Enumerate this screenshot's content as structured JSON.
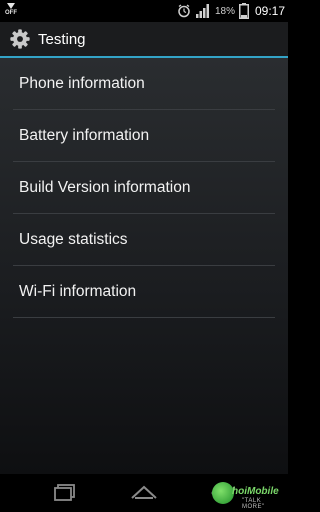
{
  "status_bar": {
    "off_label": "OFF",
    "battery_percent": "18%",
    "time": "09:17",
    "icons": [
      "download-icon",
      "alarm-icon",
      "signal-icon",
      "battery-icon"
    ]
  },
  "action_bar": {
    "title": "Testing",
    "icon": "gear-icon",
    "accent_color": "#33a3c7"
  },
  "menu": {
    "items": [
      {
        "label": "Phone information"
      },
      {
        "label": "Battery information"
      },
      {
        "label": "Build Version information"
      },
      {
        "label": "Usage statistics"
      },
      {
        "label": "Wi-Fi information"
      }
    ]
  },
  "nav_bar": {
    "buttons": [
      "recents-icon",
      "home-icon",
      "back-icon"
    ]
  },
  "watermark": {
    "brand": "hoiMobile",
    "tagline": "\"TALK MORE\""
  }
}
